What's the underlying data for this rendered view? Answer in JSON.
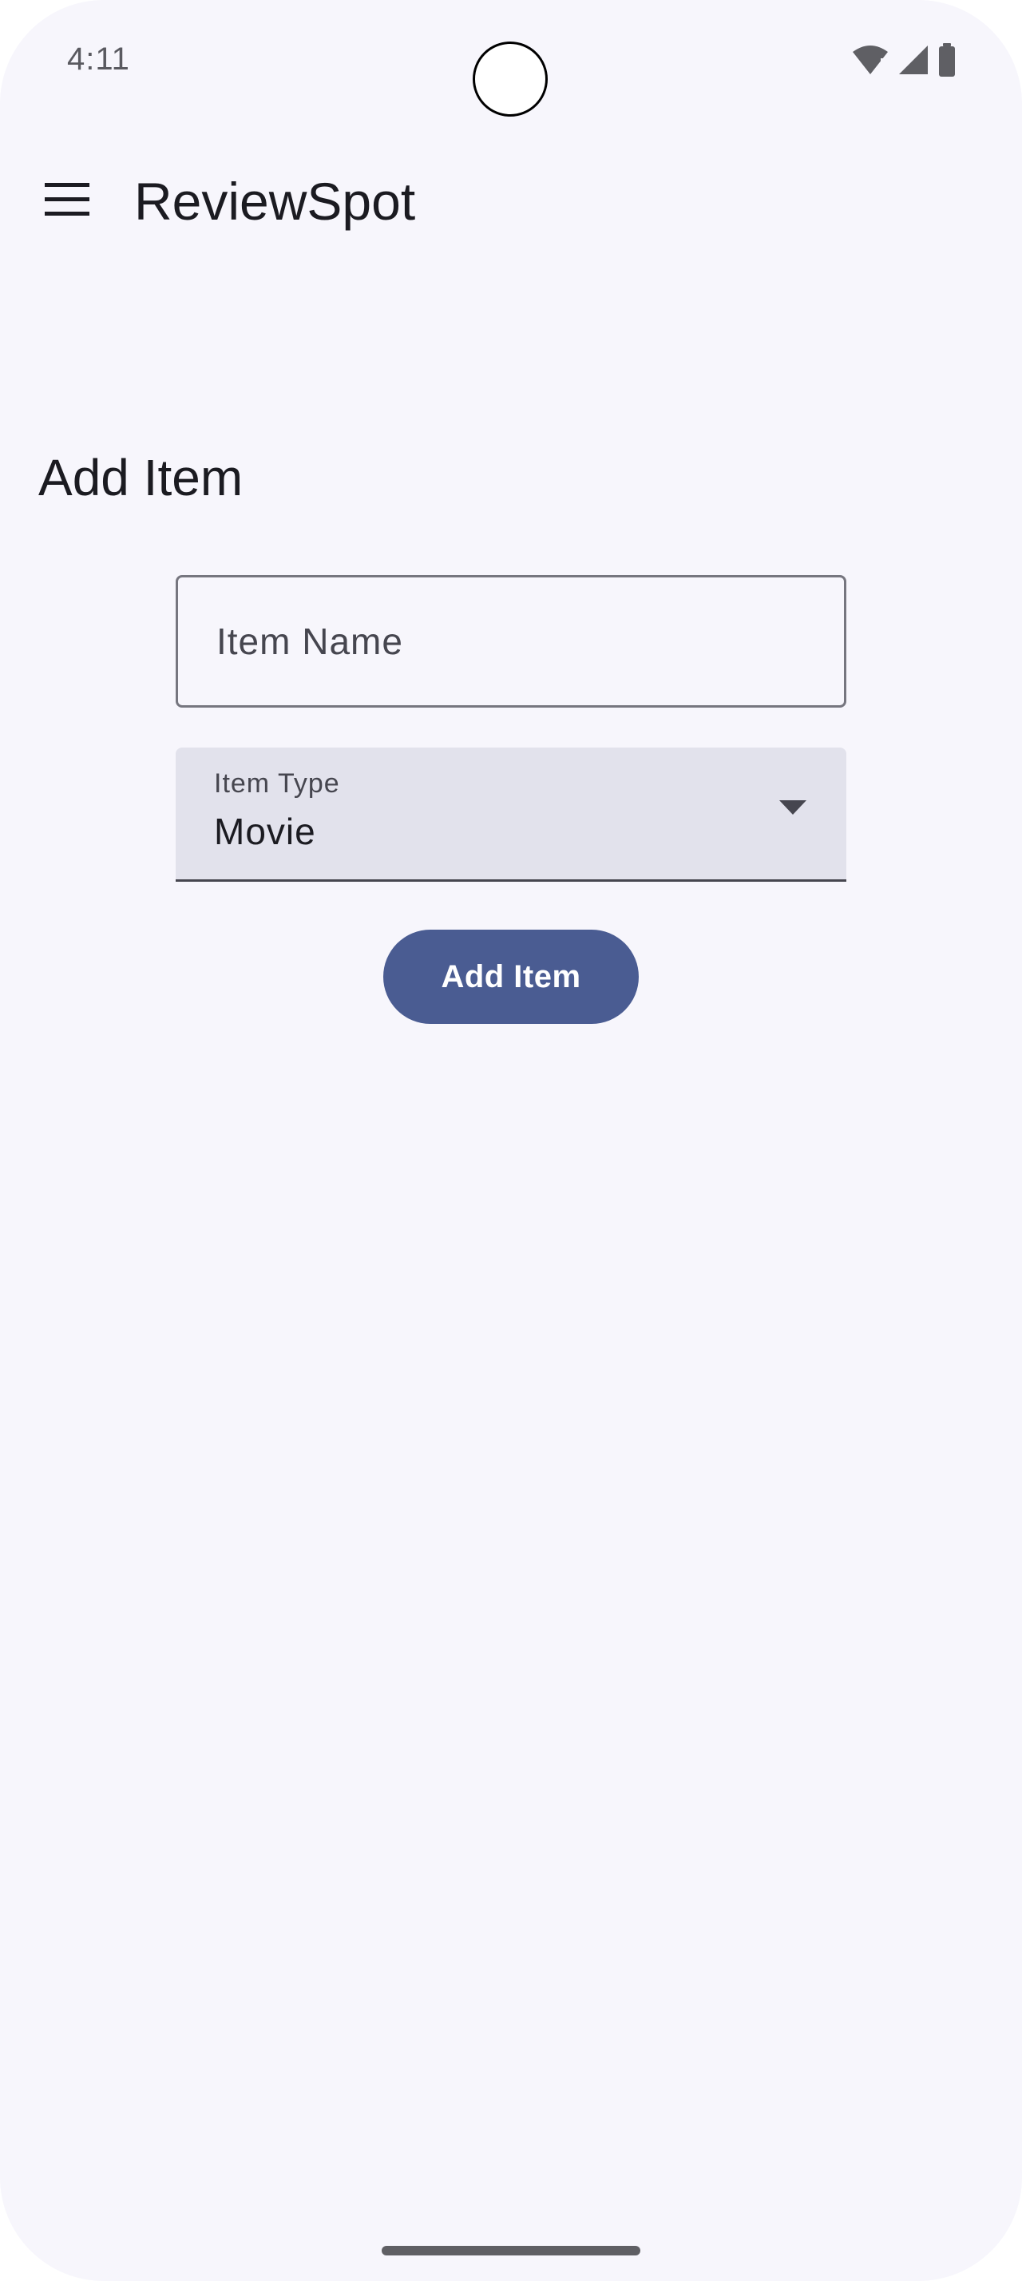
{
  "status_bar": {
    "time": "4:11",
    "icons": [
      "wifi-alert-icon",
      "cell-signal-icon",
      "battery-icon"
    ]
  },
  "app_bar": {
    "menu_icon": "menu-icon",
    "title": "ReviewSpot"
  },
  "page": {
    "title": "Add Item"
  },
  "form": {
    "item_name": {
      "value": "",
      "placeholder": "Item Name"
    },
    "item_type": {
      "label": "Item Type",
      "value": "Movie",
      "icon": "dropdown-arrow-icon"
    },
    "submit_label": "Add Item"
  },
  "colors": {
    "background": "#f7f6fc",
    "primary": "#4a5c92",
    "field_fill": "#e2e2ec",
    "outline": "#76767f",
    "text": "#1b1b21"
  }
}
